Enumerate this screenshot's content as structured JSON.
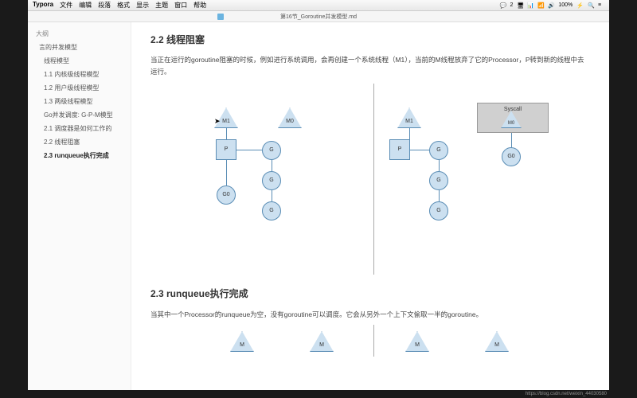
{
  "menubar": {
    "app": "Typora",
    "items": [
      "文件",
      "编辑",
      "段落",
      "格式",
      "显示",
      "主题",
      "窗口",
      "帮助"
    ],
    "status": {
      "badge": "2",
      "battery": "100%",
      "batt_icon": "⚡"
    }
  },
  "titlebar": {
    "filename": "第16节_Goroutine并发模型.md"
  },
  "sidebar": {
    "heading": "大纲",
    "items": [
      {
        "label": "言的并发模型",
        "sub": false,
        "active": false
      },
      {
        "label": "线程模型",
        "sub": true,
        "active": false
      },
      {
        "label": "1.1 内核级线程模型",
        "sub": true,
        "active": false
      },
      {
        "label": "1.2 用户级线程模型",
        "sub": true,
        "active": false
      },
      {
        "label": "1.3 两级线程模型",
        "sub": true,
        "active": false
      },
      {
        "label": "Go并发调度: G-P-M模型",
        "sub": true,
        "active": false
      },
      {
        "label": "2.1 调度器是如何工作的",
        "sub": true,
        "active": false
      },
      {
        "label": "2.2 线程阻塞",
        "sub": true,
        "active": false
      },
      {
        "label": "2.3 runqueue执行完成",
        "sub": true,
        "active": true
      }
    ]
  },
  "content": {
    "h22": "2.2 线程阻塞",
    "p22": "当正在运行的goroutine阻塞的时候，例如进行系统调用，会再创建一个系统线程（M1），当前的M线程放弃了它的Processor，P转到新的线程中去运行。",
    "h23": "2.3 runqueue执行完成",
    "p23": "当其中一个Processor的runqueue为空，没有goroutine可以调度。它会从另外一个上下文偷取一半的goroutine。"
  },
  "diagram": {
    "labels": {
      "M1": "M1",
      "M0": "M0",
      "P": "P",
      "G": "G",
      "G0": "G0",
      "Syscall": "Syscall",
      "M": "M"
    }
  },
  "footer": {
    "url": "https://blog.csdn.net/weixin_44030580"
  }
}
